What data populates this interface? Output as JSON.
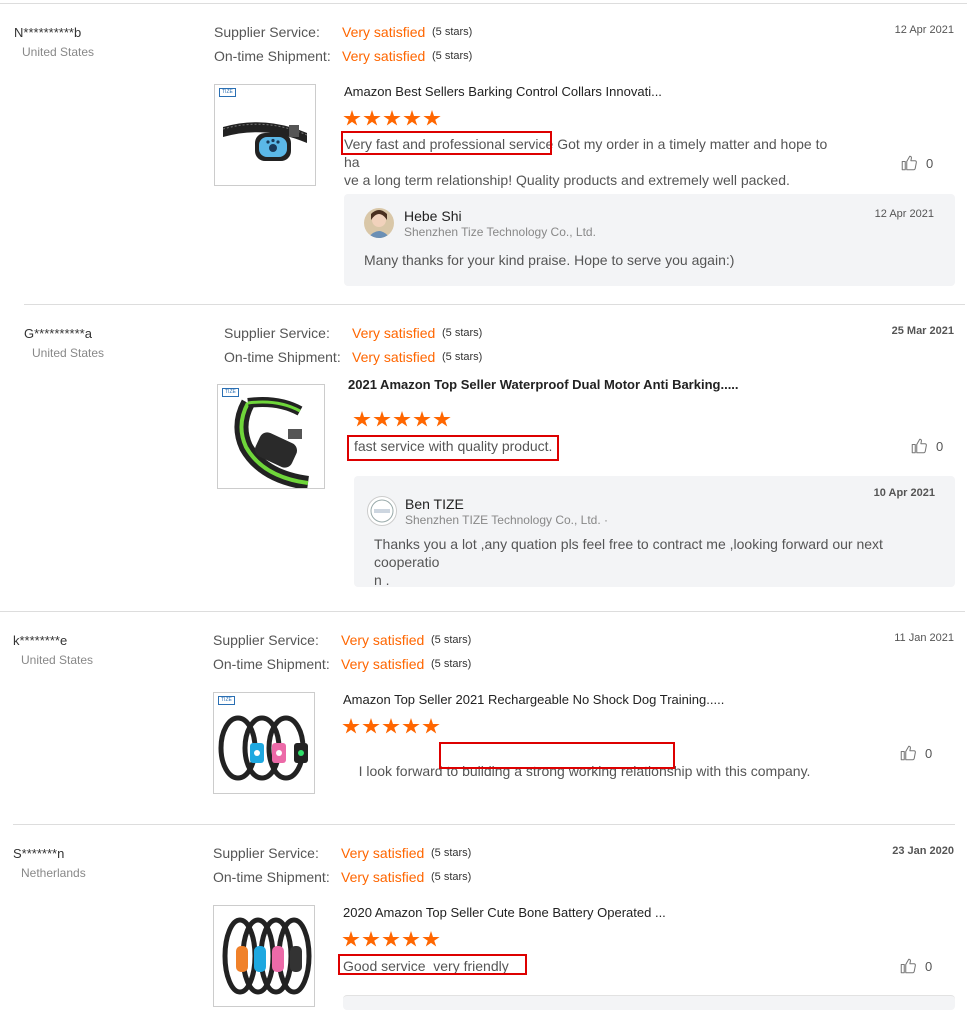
{
  "labels": {
    "supplier_service": "Supplier Service:",
    "on_time_shipment": "On-time Shipment:"
  },
  "reviews": [
    {
      "reviewer": "N**********b",
      "country": "United States",
      "date": "12 Apr 2021",
      "supplier_rating": "Very satisfied",
      "supplier_stars": "(5 stars)",
      "shipment_rating": "Very satisfied",
      "shipment_stars": "(5 stars)",
      "product_title": "Amazon Best Sellers Barking Control Collars Innovati...",
      "text_highlight": "Very fast and professional service",
      "text_line1": " Got my order in a timely matter and hope to ha",
      "text_line2": "ve a long term relationship! Quality products and extremely well packed.",
      "likes": "0",
      "reply": {
        "name": "Hebe Shi",
        "company": "Shenzhen Tize Technology Co., Ltd.",
        "date": "12 Apr 2021",
        "text": "Many thanks for your kind praise.  Hope to serve you again:)"
      }
    },
    {
      "reviewer": "G**********a",
      "country": "United States",
      "date": "25 Mar 2021",
      "supplier_rating": "Very satisfied",
      "supplier_stars": "(5 stars)",
      "shipment_rating": "Very satisfied",
      "shipment_stars": "(5 stars)",
      "product_title": "2021 Amazon Top Seller Waterproof Dual Motor Anti Barking.....",
      "text_highlight": "fast service with quality product.",
      "likes": "0",
      "reply": {
        "name": "Ben TIZE",
        "company": "Shenzhen TIZE Technology Co., Ltd. ·",
        "date": "10 Apr 2021",
        "text_line1": "Thanks you a lot ,any quation pls feel free to contract me ,looking forward our next cooperatio",
        "text_line2": "n ."
      }
    },
    {
      "reviewer": "k********e",
      "country": "United States",
      "date": "11 Jan 2021",
      "supplier_rating": "Very satisfied",
      "supplier_stars": "(5 stars)",
      "shipment_rating": "Very satisfied",
      "shipment_stars": "(5 stars)",
      "product_title": "Amazon Top Seller 2021 Rechargeable No Shock Dog Training.....",
      "text_before": "I look forward to ",
      "text_highlight": "building a strong working relationship",
      "text_after": " with this company.",
      "likes": "0"
    },
    {
      "reviewer": "S*******n",
      "country": "Netherlands",
      "date": "23 Jan 2020",
      "supplier_rating": "Very satisfied",
      "supplier_stars": "(5 stars)",
      "shipment_rating": "Very satisfied",
      "shipment_stars": "(5 stars)",
      "product_title": "2020 Amazon Top Seller Cute Bone Battery Operated ...",
      "text_highlight": "Good service  very friendly",
      "likes": "0"
    }
  ],
  "brand_mark": "TIZE",
  "colors": {
    "accent": "#ff6600",
    "highlight_box": "#dd0000",
    "reply_bg": "#f3f4f6"
  },
  "icons": [
    "thumbs-up-icon",
    "star-icon",
    "avatar-icon"
  ]
}
